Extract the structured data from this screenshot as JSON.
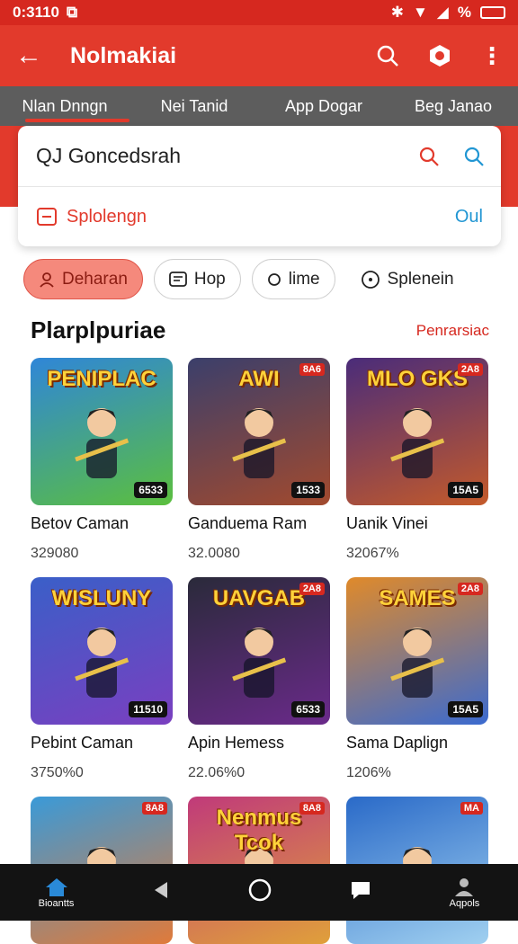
{
  "status": {
    "time": "0:3110",
    "battery": "%"
  },
  "appbar": {
    "title": "Nolmakiai"
  },
  "tabs": [
    {
      "label": "Nlan Dnngn"
    },
    {
      "label": "Nei Tanid"
    },
    {
      "label": "App Dogar"
    },
    {
      "label": "Beg Janao"
    }
  ],
  "search": {
    "query": "QJ Goncedsrah",
    "suggestion": "Splolengn",
    "suggestion_action": "Oul"
  },
  "chips": [
    {
      "label": "Deharan",
      "icon": "person-icon"
    },
    {
      "label": "Hop",
      "icon": "message-icon"
    },
    {
      "label": "lime",
      "icon": "circle-icon"
    },
    {
      "label": "Splenein",
      "icon": "compass-icon"
    }
  ],
  "section": {
    "title": "Plarplpuriae",
    "more": "Penrarsiac"
  },
  "games": [
    {
      "title_art": "PENIPLAC",
      "name": "Betov Caman",
      "price": "329080",
      "badge": "6533",
      "colors": [
        "#2f86d8",
        "#5bbf3e"
      ]
    },
    {
      "title_art": "AWI",
      "name": "Ganduema Ram",
      "price": "32.0080",
      "badge": "1533",
      "tag": "8A6",
      "colors": [
        "#3b3f6b",
        "#a24a2e"
      ]
    },
    {
      "title_art": "MLO GKS",
      "name": "Uanik Vinei",
      "price": "32067%",
      "badge": "15A5",
      "tag": "2A8",
      "colors": [
        "#4a2c7a",
        "#c45a2a"
      ]
    },
    {
      "title_art": "WISLUNY",
      "name": "Pebint Caman",
      "price": "3750%0",
      "badge": "11510",
      "colors": [
        "#3a5fc8",
        "#7a3fc0"
      ]
    },
    {
      "title_art": "UAVGAB",
      "name": "Apin Hemess",
      "price": "22.06%0",
      "badge": "6533",
      "tag": "2A8",
      "colors": [
        "#2a2a3a",
        "#6a2a8a"
      ]
    },
    {
      "title_art": "SAMES",
      "name": "Sama Daplign",
      "price": "1206%",
      "badge": "15A5",
      "tag": "2A8",
      "colors": [
        "#e08a2a",
        "#3a6ad0"
      ]
    },
    {
      "title_art": "",
      "name": "",
      "price": "",
      "badge": "",
      "tag": "8A8",
      "colors": [
        "#3a9ad8",
        "#e07a3a"
      ]
    },
    {
      "title_art": "Nenmus Tcok",
      "name": "",
      "price": "",
      "badge": "",
      "tag": "8A8",
      "colors": [
        "#c03a7a",
        "#e0a03a"
      ]
    },
    {
      "title_art": "",
      "name": "",
      "price": "",
      "badge": "",
      "tag": "MA",
      "colors": [
        "#2a6ac8",
        "#a0d0f0"
      ]
    }
  ],
  "nav": {
    "home": "Bioantts",
    "profile": "Aqpols"
  }
}
